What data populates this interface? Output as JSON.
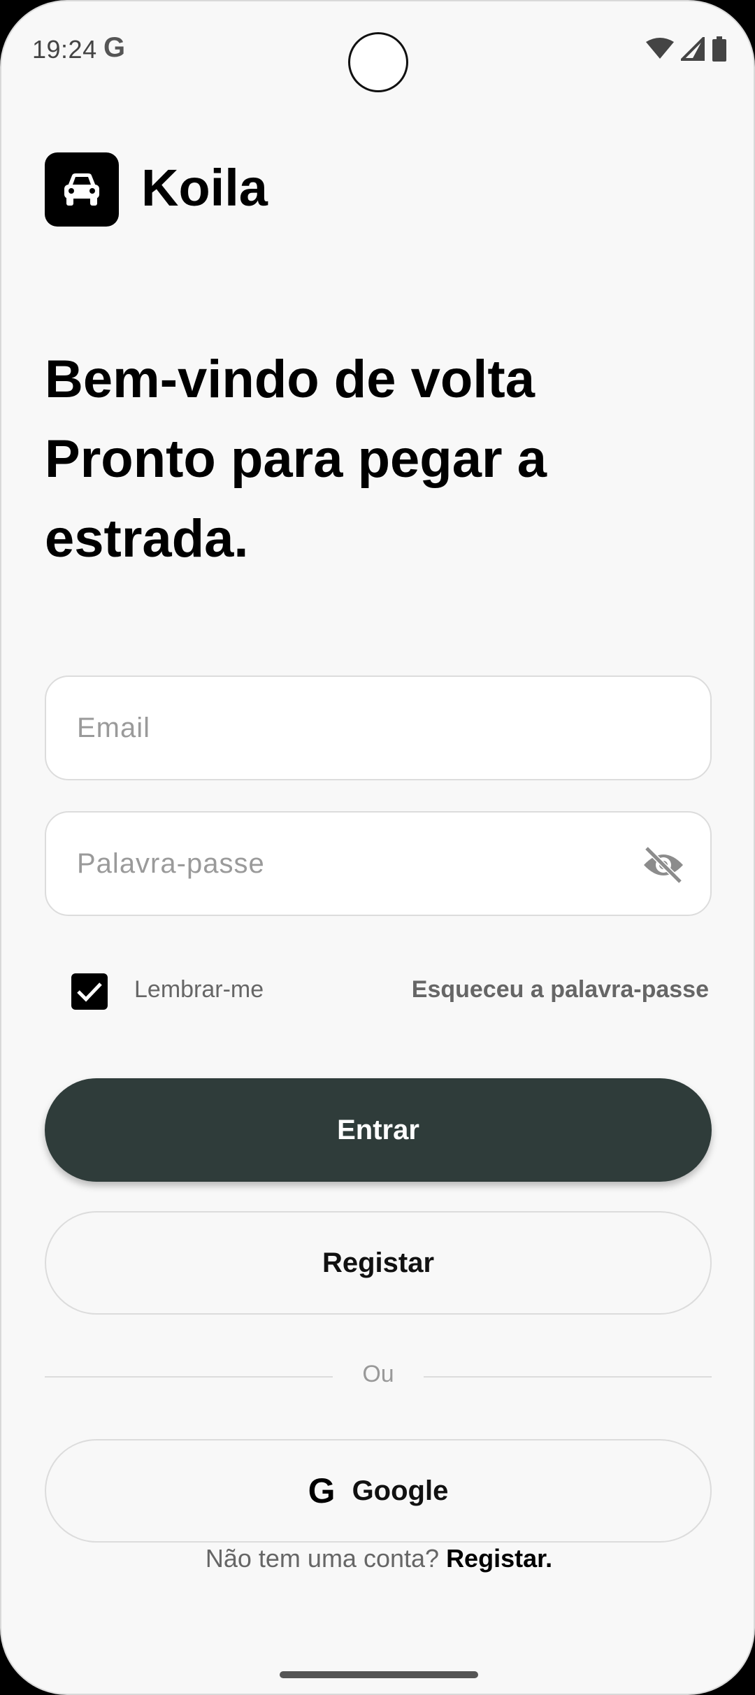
{
  "status_bar": {
    "time": "19:24",
    "g_icon": "G"
  },
  "app": {
    "name": "Koila",
    "logo_icon": "car-icon"
  },
  "greeting": {
    "line1": "Bem-vindo de volta",
    "line2": "Pronto para pegar a estrada."
  },
  "form": {
    "email_placeholder": "Email",
    "email_value": "",
    "password_placeholder": "Palavra-passe",
    "password_value": "",
    "remember_label": "Lembrar-me",
    "remember_checked": true,
    "forgot_label": "Esqueceu a palavra-passe"
  },
  "buttons": {
    "login_label": "Entrar",
    "register_label": "Registar",
    "divider_label": "Ou",
    "google_g": "G",
    "google_label": "Google"
  },
  "footer": {
    "prompt": "Não tem uma conta?",
    "link": "Registar."
  },
  "colors": {
    "primary": "#2f3c3a",
    "background": "#f8f8f8"
  }
}
